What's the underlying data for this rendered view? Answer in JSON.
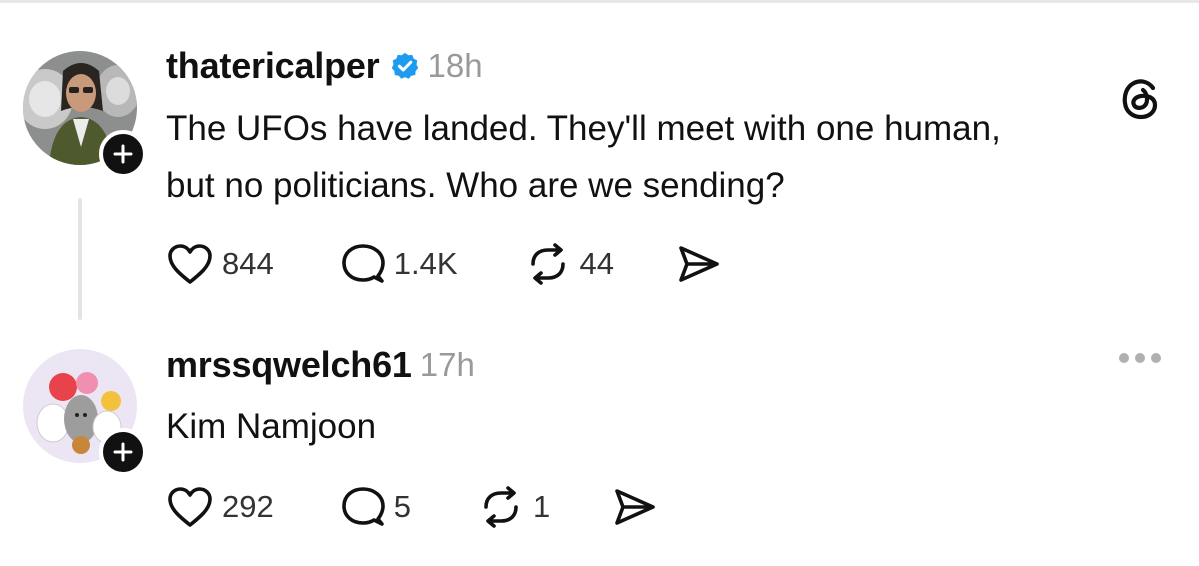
{
  "post": {
    "username": "thatericalper",
    "verified": true,
    "timestamp": "18h",
    "text_line1": "The UFOs have landed. They'll meet with one human,",
    "text_line2": "but no politicians. Who are we sending?",
    "likes": "844",
    "replies": "1.4K",
    "reposts": "44"
  },
  "reply": {
    "username": "mrssqwelch61",
    "timestamp": "17h",
    "text": "Kim Namjoon",
    "likes": "292",
    "replies": "5",
    "reposts": "1"
  },
  "icons": {
    "like": "heart-icon",
    "reply": "comment-bubble-icon",
    "repost": "repost-icon",
    "share": "send-icon",
    "verified": "verified-badge-icon",
    "follow": "plus-icon",
    "app": "threads-logo-icon",
    "more": "more-horizontal-icon"
  },
  "colors": {
    "verified_blue": "#1d9bf0",
    "timestamp_gray": "#999999",
    "text": "#111111"
  }
}
